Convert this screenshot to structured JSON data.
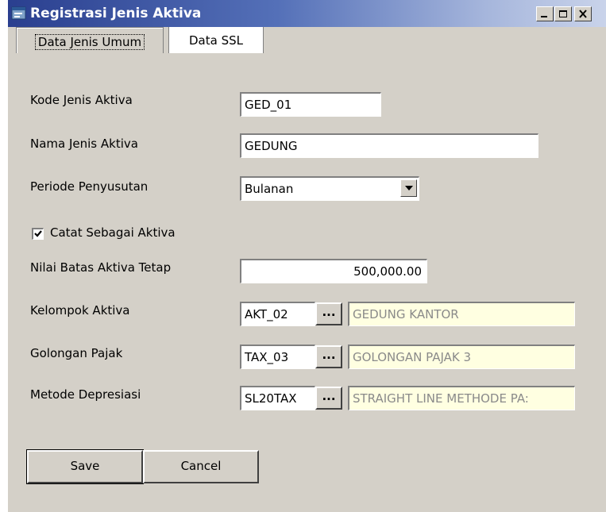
{
  "window": {
    "title": "Registrasi Jenis Aktiva"
  },
  "tabs": [
    {
      "label": "Data Jenis Umum",
      "active": true
    },
    {
      "label": "Data SSL",
      "active": false
    }
  ],
  "form": {
    "kode": {
      "label": "Kode Jenis Aktiva",
      "value": "GED_01"
    },
    "nama": {
      "label": "Nama Jenis Aktiva",
      "value": "GEDUNG"
    },
    "periode": {
      "label": "Periode Penyusutan",
      "value": "Bulanan"
    },
    "catat": {
      "label": "Catat Sebagai Aktiva",
      "checked": true
    },
    "nilai": {
      "label": "Nilai Batas Aktiva Tetap",
      "value": "500,000.00"
    },
    "kelompok": {
      "label": "Kelompok Aktiva",
      "code": "AKT_02",
      "description": "GEDUNG KANTOR"
    },
    "golongan": {
      "label": "Golongan Pajak",
      "code": "TAX_03",
      "description": "GOLONGAN PAJAK 3"
    },
    "metode": {
      "label": "Metode Depresiasi",
      "code": "SL20TAX",
      "description": "STRAIGHT LINE METHODE PA:"
    },
    "ellipsis": "..."
  },
  "buttons": {
    "save": "Save",
    "cancel": "Cancel"
  },
  "icons": {
    "app": "form-window-icon",
    "minimize": "minimize-icon",
    "maximize": "maximize-icon",
    "close": "close-icon",
    "dropdown": "chevron-down-icon",
    "check": "checkmark-icon"
  },
  "colors": {
    "titlebar_start": "#2a3f8f",
    "titlebar_end": "#c9d3ea",
    "window_bg": "#d4d0c8",
    "readonly_bg": "#ffffe1",
    "readonly_text": "#8a8a8a"
  }
}
